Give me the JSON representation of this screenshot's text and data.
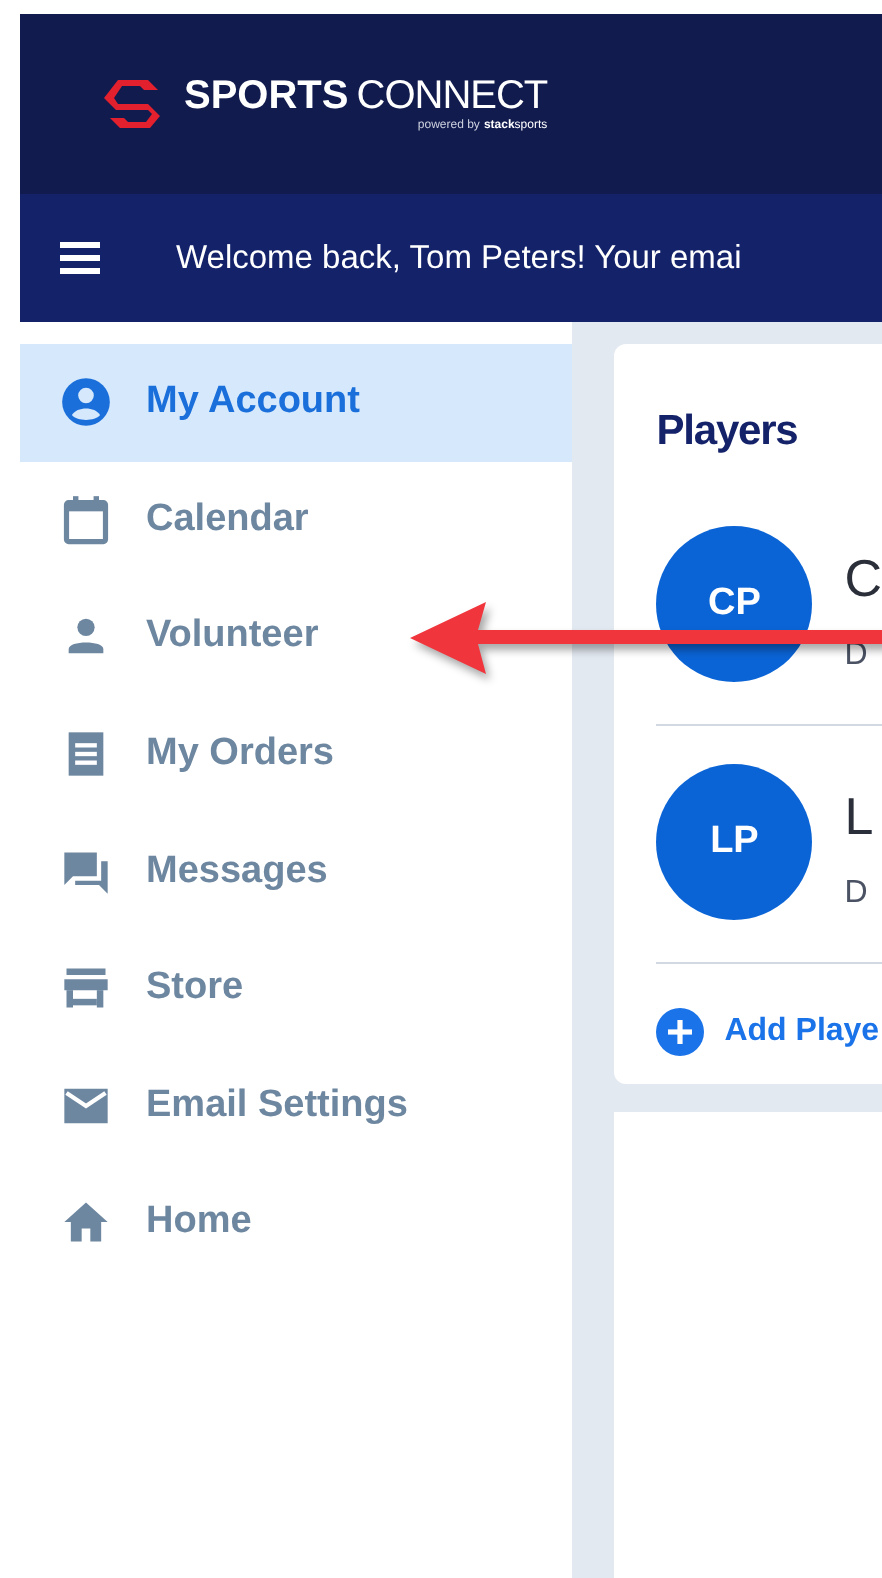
{
  "header": {
    "brand_bold": "SPORTS",
    "brand_light": "CONNECT",
    "tagline": "powered by",
    "partner": "**stack**sports"
  },
  "nav_bar": {
    "message": "Welcome back, Tom Peters! Your emai"
  },
  "sidebar": {
    "items": [
      {
        "label": "My Account",
        "kind": "account",
        "selected": true
      },
      {
        "label": "Calendar",
        "kind": "calendar",
        "selected": false
      },
      {
        "label": "Volunteer",
        "kind": "person",
        "selected": false
      },
      {
        "label": "My Orders",
        "kind": "receipt",
        "selected": false
      },
      {
        "label": "Messages",
        "kind": "chat",
        "selected": false
      },
      {
        "label": "Store",
        "kind": "store",
        "selected": false
      },
      {
        "label": "Email Settings",
        "kind": "mail",
        "selected": false
      },
      {
        "label": "Home",
        "kind": "home",
        "selected": false
      }
    ]
  },
  "players": {
    "title": "Players",
    "items": [
      {
        "initials": "CP",
        "name": "C",
        "detail": "D"
      },
      {
        "initials": "LP",
        "name": "L",
        "detail": "D"
      }
    ],
    "add_link": "Add Playe"
  }
}
